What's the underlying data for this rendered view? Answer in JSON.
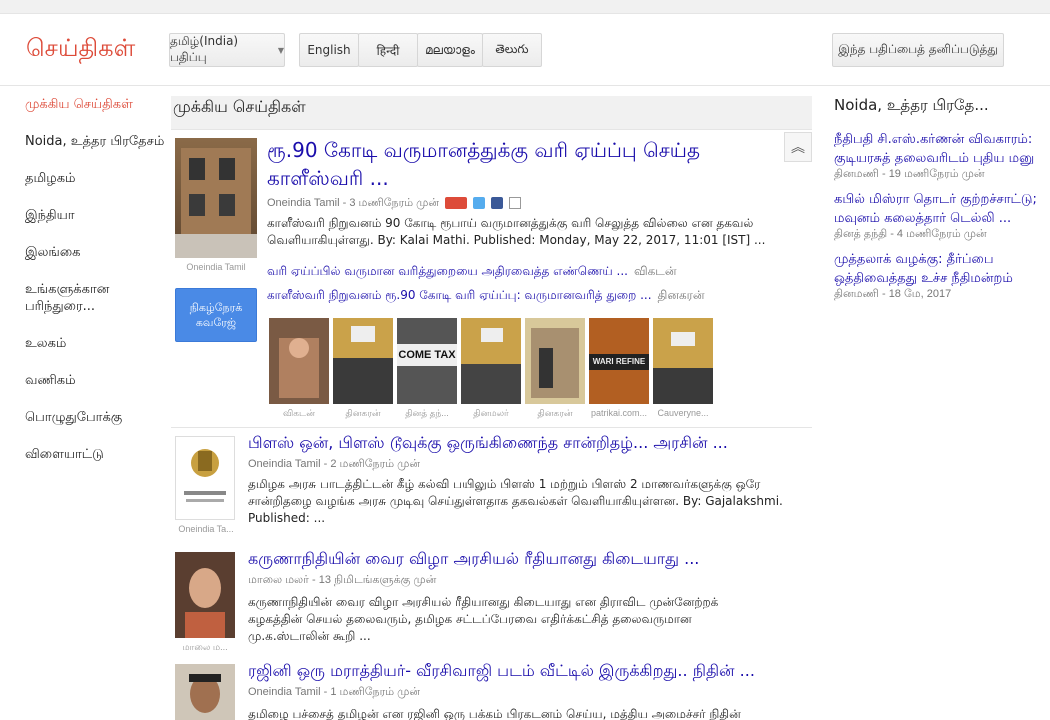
{
  "header": {
    "logo": "செய்திகள்",
    "edition": "தமிழ்(India) பதிப்பு",
    "languages": [
      "English",
      "हिन्दी",
      "മലയാളം",
      "తెలుగు"
    ],
    "personalize": "இந்த பதிப்பைத் தனிப்படுத்து"
  },
  "nav": {
    "items": [
      "முக்கிய செய்திகள்",
      "Noida, உத்தர பிரதேசம்",
      "தமிழகம்",
      "இந்தியா",
      "இலங்கை",
      "உங்களுக்கான பரிந்துரை...",
      "உலகம்",
      "வணிகம்",
      "பொழுதுபோக்கு",
      "விளையாட்டு"
    ]
  },
  "section_title": "முக்கிய செய்திகள்",
  "story1": {
    "title": "ரூ.90 கோடி வருமானத்துக்கு வரி ஏய்ப்பு செய்த காளீஸ்வரி ...",
    "source": "Oneindia Tamil",
    "time": "3 மணிநேரம் முன்",
    "snippet": "காளீஸ்வரி நிறுவனம் 90 கோடி ரூபாய் வருமானத்துக்கு வரி செலுத்த வில்லை என தகவல் வெளியாகியுள்ளது. By: Kalai Mathi. Published: Monday, May 22, 2017, 11:01 [IST] ...",
    "thumb_source": "Oneindia Tamil",
    "related": [
      {
        "text": "வரி ஏய்ப்பில் வருமான வரித்துறையை அதிரவைத்த எண்ணெய் ...",
        "source": "விகடன்"
      },
      {
        "text": "காளீஸ்வரி நிறுவனம் ரூ.90 கோடி வரி ஏய்ப்பு: வருமானவரித் துறை ...",
        "source": "தினகரன்"
      }
    ],
    "live_button": "நிகழ்நேரக் கவரேஜ்",
    "strip_captions": [
      "விகடன்",
      "தினகரன்",
      "தினத் தந்...",
      "தினமலர்",
      "தினகரன்",
      "patrikai.com...",
      "Cauveryne..."
    ],
    "strip_text_come_tax": "COME TAX",
    "strip_text_refine": "WARI REFINE"
  },
  "stories": [
    {
      "title": "பிளஸ் ஒன், பிளஸ் டூவுக்கு ஒருங்கிணைந்த சான்றிதழ்... அரசின் ...",
      "source": "Oneindia Tamil",
      "time": "2 மணிநேரம் முன்",
      "snippet": "தமிழக அரசு பாடத்திட்டன் கீழ் கல்வி பயிலும் பிளஸ் 1 மற்றும் பிளஸ் 2 மாணவர்களுக்கு ஒரே சான்றிதழை வழங்க அரசு முடிவு செய்துள்ளதாக தகவல்கள் வெளியாகியுள்ளன. By: Gajalakshmi. Published: ...",
      "thumb_source": "Oneindia Ta..."
    },
    {
      "title": "கருணாநிதியின் வைர விழா அரசியல் ரீதியானது கிடையாது ...",
      "source": "மாலை மலர்",
      "time": "13 நிமிடங்களுக்கு முன்",
      "snippet": "கருணாநிதியின் வைர விழா அரசியல் ரீதியானது கிடையாது என திராவிட முன்னேற்றக் கழகத்தின் செயல் தலைவரும், தமிழக சட்டப்பேரவை எதிர்க்கட்சித் தலைவருமான மு.க.ஸ்டாலின் கூறி ...",
      "thumb_source": "மாலை ம..."
    },
    {
      "title": "ரஜினி ஒரு மராத்தியர்- வீரசிவாஜி படம் வீட்டில் இருக்கிறது.. நிதின் ...",
      "source": "Oneindia Tamil",
      "time": "1 மணிநேரம் முன்",
      "snippet": "தமிழை பச்சைத் தமிழன் என ரஜினி ஒரு பக்கம் பிரகடனம் செய்ய, மத்திய அமைச்சர் நிதின்"
    }
  ],
  "right": {
    "title": "Noida, உத்தர பிரதே...",
    "items": [
      {
        "text": "நீதிபதி சி.எஸ்.கர்ணன் விவகாரம்: குடியரசுத் தலைவரிடம் புதிய மனு",
        "source": "தினமணி",
        "time": "19 மணிநேரம் முன்"
      },
      {
        "text": "கபில் மிஸ்ரா தொடர் குற்றச்சாட்டு; மவுனம் கலைத்தார் டெல்லி ...",
        "source": "தினத் தந்தி",
        "time": "4 மணிநேரம் முன்"
      },
      {
        "text": "முத்தலாக் வழக்கு: தீர்ப்பை ஒத்திவைத்தது உச்ச நீதிமன்றம்",
        "source": "தினமணி",
        "time": "18 மே, 2017"
      }
    ]
  },
  "colors": {
    "link": "#1a0dab",
    "accent": "#dd4b39",
    "live": "#4a8ae6"
  }
}
